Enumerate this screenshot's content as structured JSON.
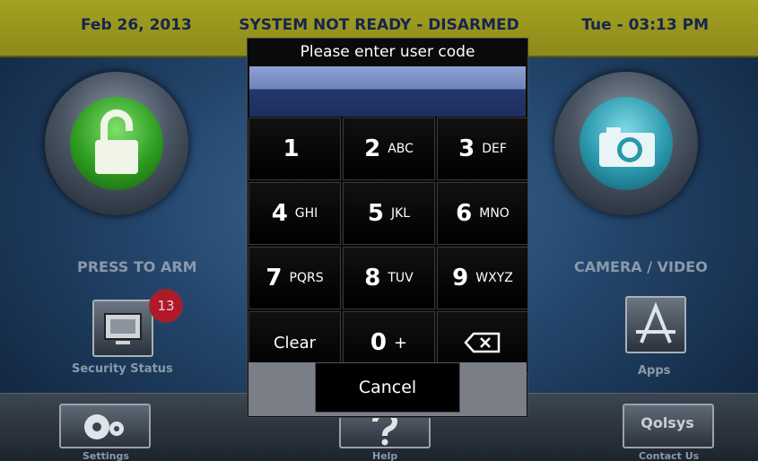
{
  "topbar": {
    "date": "Feb 26, 2013",
    "status": "SYSTEM NOT READY - DISARMED",
    "time": "Tue - 03:13 PM"
  },
  "main": {
    "arm_label": "PRESS TO ARM",
    "camera_label": "CAMERA / VIDEO",
    "security_label": "Security Status",
    "security_badge": "13",
    "apps_label": "Apps"
  },
  "bottom": {
    "settings_label": "Settings",
    "help_label": "Help",
    "contact_label": "Contact Us",
    "logo_text": "Qolsys"
  },
  "keypad": {
    "title": "Please enter user code",
    "code_value": "",
    "keys": [
      {
        "num": "1",
        "letters": ""
      },
      {
        "num": "2",
        "letters": "ABC"
      },
      {
        "num": "3",
        "letters": "DEF"
      },
      {
        "num": "4",
        "letters": "GHI"
      },
      {
        "num": "5",
        "letters": "JKL"
      },
      {
        "num": "6",
        "letters": "MNO"
      },
      {
        "num": "7",
        "letters": "PQRS"
      },
      {
        "num": "8",
        "letters": "TUV"
      },
      {
        "num": "9",
        "letters": "WXYZ"
      }
    ],
    "clear_label": "Clear",
    "zero": {
      "num": "0",
      "letters": "+"
    },
    "backspace_icon": "backspace-icon",
    "cancel_label": "Cancel"
  },
  "colors": {
    "topbar": "#9a9820",
    "arm_green": "#2e9c21",
    "camera_teal": "#2a98ac",
    "badge_red": "#b0192a"
  }
}
